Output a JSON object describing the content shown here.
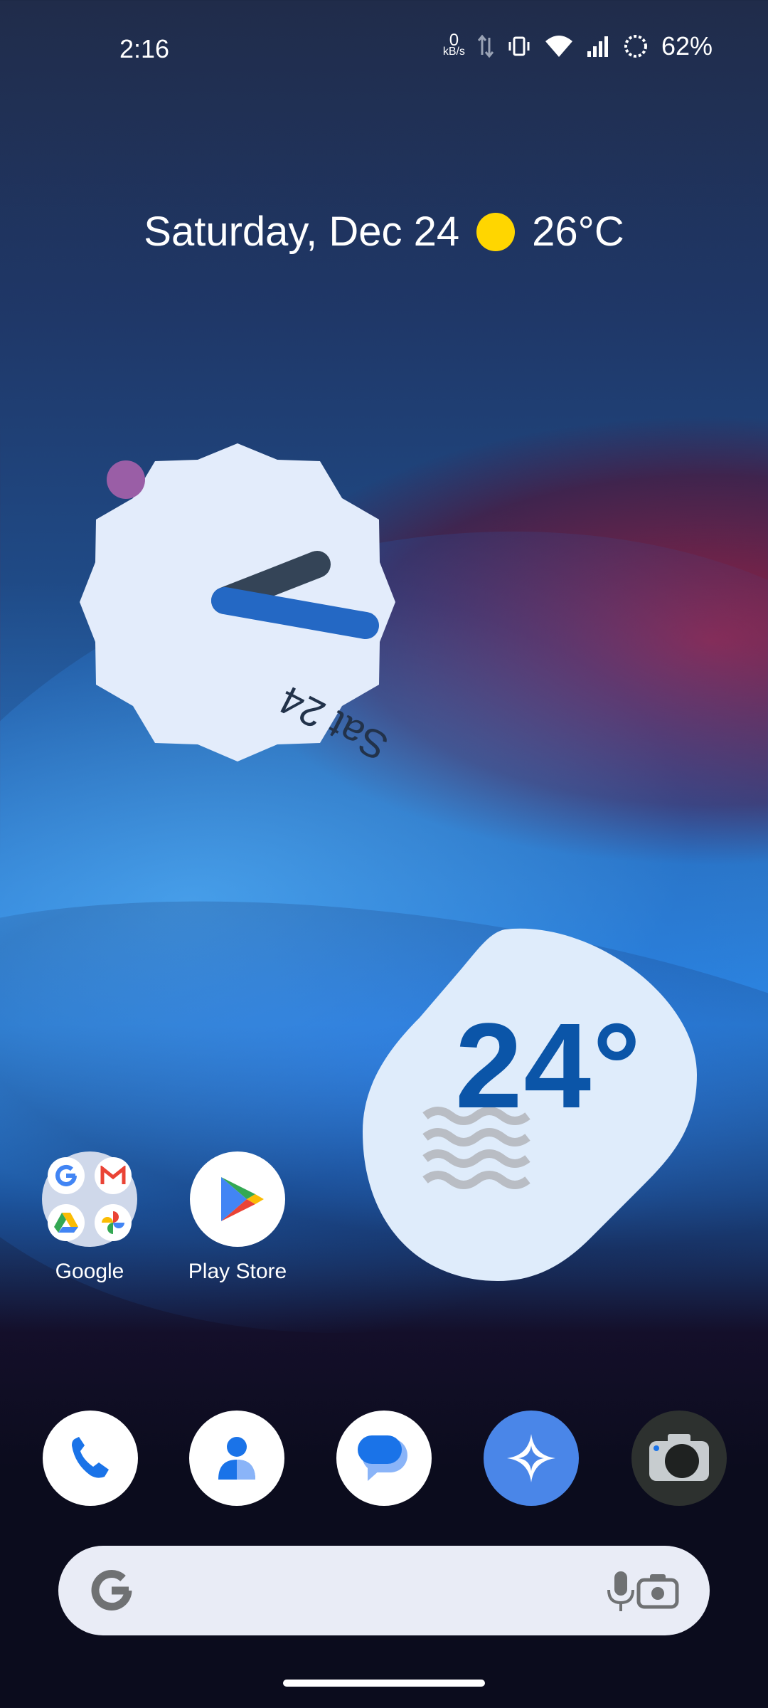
{
  "status_bar": {
    "time": "2:16",
    "net_speed_value": "0",
    "net_speed_unit": "kB/s",
    "battery_percent": "62%",
    "icons": [
      "data-arrows-icon",
      "vibrate-icon",
      "wifi-icon",
      "signal-icon",
      "battery-ring-icon"
    ]
  },
  "date_weather": {
    "date": "Saturday, Dec 24",
    "temperature": "26°C",
    "weather_icon": "sun-icon",
    "sun_color": "#ffd600"
  },
  "clock_widget": {
    "date_label": "Sat 24"
  },
  "weather_widget": {
    "temperature": "24°",
    "condition_icon": "haze-waves-icon",
    "temp_color": "#0b55a8"
  },
  "apps": [
    {
      "label": "Google",
      "icon": "google-folder-icon"
    },
    {
      "label": "Play Store",
      "icon": "play-store-icon"
    }
  ],
  "dock": [
    {
      "icon": "phone-icon"
    },
    {
      "icon": "contacts-icon"
    },
    {
      "icon": "messages-icon"
    },
    {
      "icon": "gemini-icon"
    },
    {
      "icon": "camera-icon"
    }
  ],
  "search_bar": {
    "icons": [
      "google-g-icon",
      "microphone-icon",
      "lens-icon"
    ]
  }
}
